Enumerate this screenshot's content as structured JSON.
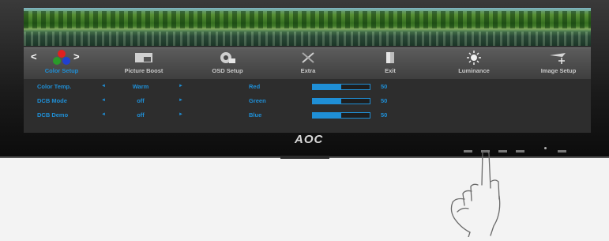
{
  "brand": {
    "logo_text": "AOC"
  },
  "colors": {
    "accent": "#1f8fd6",
    "bar_fill": "#1f8fd6",
    "osd_bg": "#2d2d2d"
  },
  "osd": {
    "nav": {
      "prev_arrow": "<",
      "next_arrow": ">",
      "items": [
        {
          "label": "Color Setup",
          "icon": "rgb-dots-icon",
          "active": true
        },
        {
          "label": "Picture Boost",
          "icon": "picture-boost-icon",
          "active": false
        },
        {
          "label": "OSD Setup",
          "icon": "osd-setup-icon",
          "active": false
        },
        {
          "label": "Extra",
          "icon": "extra-tools-icon",
          "active": false
        },
        {
          "label": "Exit",
          "icon": "exit-door-icon",
          "active": false
        },
        {
          "label": "Luminance",
          "icon": "luminance-sun-icon",
          "active": false
        },
        {
          "label": "Image Setup",
          "icon": "image-setup-icon",
          "active": false
        }
      ]
    },
    "settings": [
      {
        "name": "Color Temp.",
        "value": "Warm",
        "left_arrow": "◄",
        "right_arrow": "►"
      },
      {
        "name": "DCB Mode",
        "value": "off",
        "left_arrow": "◄",
        "right_arrow": "►"
      },
      {
        "name": "DCB Demo",
        "value": "off",
        "left_arrow": "◄",
        "right_arrow": "►"
      }
    ],
    "channels": [
      {
        "name": "Red",
        "value": "50",
        "level": 0.5
      },
      {
        "name": "Green",
        "value": "50",
        "level": 0.5
      },
      {
        "name": "Blue",
        "value": "50",
        "level": 0.5
      }
    ]
  }
}
